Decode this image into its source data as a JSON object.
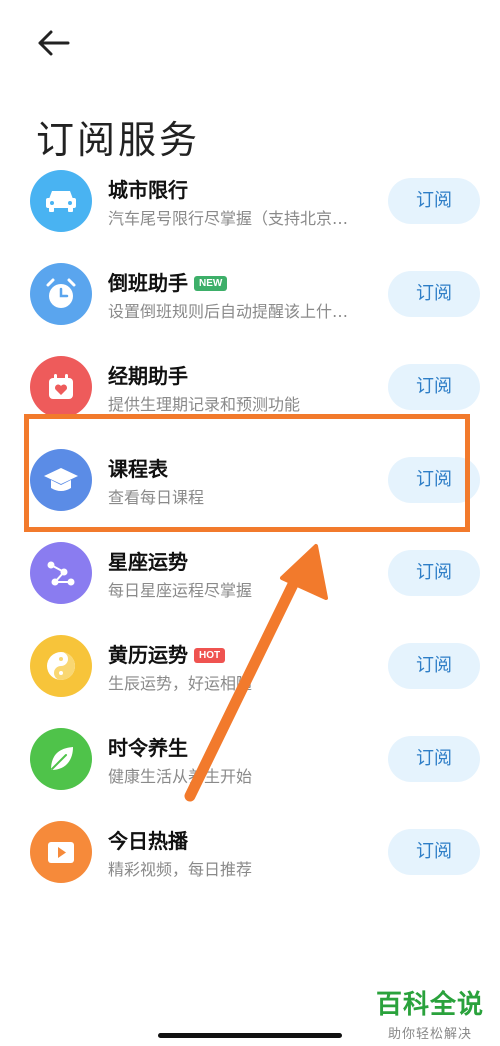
{
  "page": {
    "title": "订阅服务"
  },
  "services": [
    {
      "key": "city",
      "name": "城市限行",
      "desc": "汽车尾号限行尽掌握（支持北京…",
      "button": "订阅",
      "icon": "car-icon",
      "color": "#49b3f2"
    },
    {
      "key": "shift",
      "name": "倒班助手",
      "badge": "NEW",
      "badge_color": "#3daf69",
      "desc": "设置倒班规则后自动提醒该上什…",
      "button": "订阅",
      "icon": "alarm-clock-icon",
      "color": "#5aa5ee"
    },
    {
      "key": "period",
      "name": "经期助手",
      "desc": "提供生理期记录和预测功能",
      "button": "订阅",
      "icon": "calendar-heart-icon",
      "color": "#ee5b5b"
    },
    {
      "key": "schedule",
      "name": "课程表",
      "desc": "查看每日课程",
      "button": "订阅",
      "icon": "graduation-cap-icon",
      "color": "#5b8ce6"
    },
    {
      "key": "horoscope",
      "name": "星座运势",
      "desc": "每日星座运程尽掌握",
      "button": "订阅",
      "icon": "constellation-icon",
      "color": "#8a7cf0"
    },
    {
      "key": "almanac",
      "name": "黄历运势",
      "badge": "HOT",
      "badge_color": "#ef5350",
      "desc": "生辰运势，好运相随",
      "button": "订阅",
      "icon": "yin-yang-icon",
      "color": "#f7c43a"
    },
    {
      "key": "health",
      "name": "时令养生",
      "desc": "健康生活从养生开始",
      "button": "订阅",
      "icon": "leaf-icon",
      "color": "#4fc34a"
    },
    {
      "key": "video",
      "name": "今日热播",
      "desc": "精彩视频，每日推荐",
      "button": "订阅",
      "icon": "video-play-icon",
      "color": "#f68a3a"
    }
  ],
  "annotation": {
    "highlight_target": "课程表",
    "color": "#f27a2c"
  },
  "watermark": {
    "main": "百科全说",
    "sub": "助你轻松解决"
  }
}
